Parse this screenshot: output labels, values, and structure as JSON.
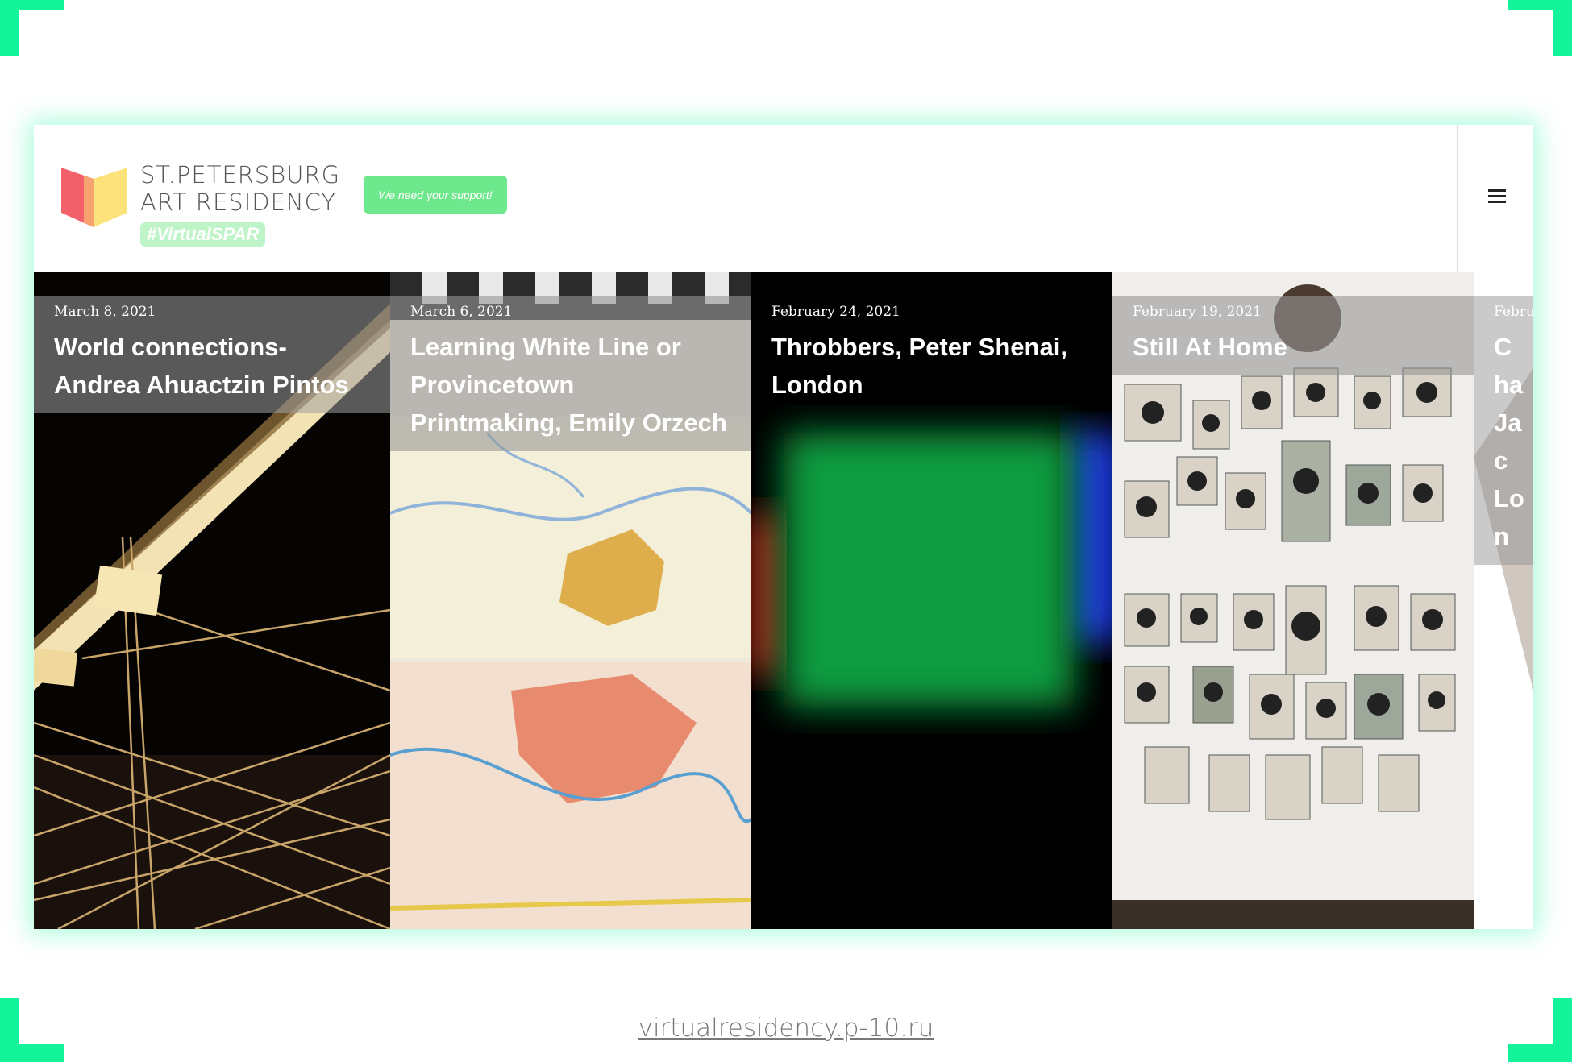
{
  "brand": {
    "line1": "ST.PETERSBURG",
    "line2": "ART RESIDENCY",
    "tag": "#VirtualSPAR",
    "logo_icon": "book-cube-logo",
    "colors": {
      "accent": "#12f39a",
      "support": "#6ee88c",
      "logo_red": "#f2606b",
      "logo_yellow": "#fbe27a"
    }
  },
  "header": {
    "support_label": "We need your support!",
    "menu_icon": "hamburger-menu-icon"
  },
  "posts": [
    {
      "date": "March 8, 2021",
      "title": "World connections- Andrea Ahuactzin Pintos"
    },
    {
      "date": "March 6, 2021",
      "title": "Learning White Line or Provincetown Printmaking, Emily Orzech"
    },
    {
      "date": "February 24, 2021",
      "title": "Throbbers, Peter Shenai, London"
    },
    {
      "date": "February 19, 2021",
      "title": "Still At Home"
    },
    {
      "date": "Febru",
      "title": "Cha Jac Lon"
    }
  ],
  "footer": {
    "url": "virtualresidency.p-10.ru"
  }
}
